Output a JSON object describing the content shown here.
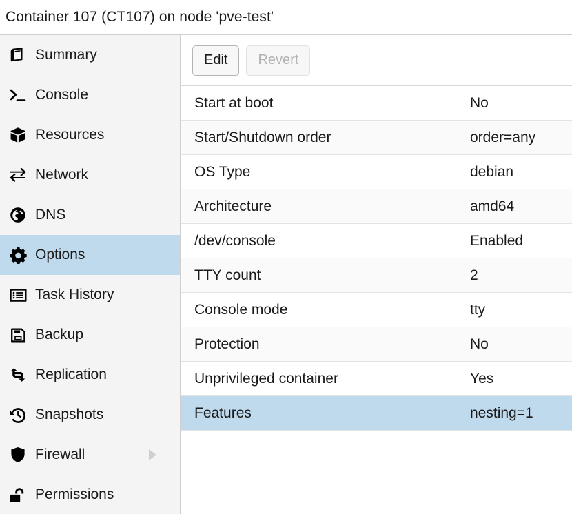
{
  "header": {
    "title": "Container 107 (CT107) on node 'pve-test'"
  },
  "sidebar": {
    "items": [
      {
        "label": "Summary",
        "icon": "book-icon",
        "selected": false,
        "has_submenu": false
      },
      {
        "label": "Console",
        "icon": "terminal-icon",
        "selected": false,
        "has_submenu": false
      },
      {
        "label": "Resources",
        "icon": "cube-icon",
        "selected": false,
        "has_submenu": false
      },
      {
        "label": "Network",
        "icon": "exchange-icon",
        "selected": false,
        "has_submenu": false
      },
      {
        "label": "DNS",
        "icon": "globe-icon",
        "selected": false,
        "has_submenu": false
      },
      {
        "label": "Options",
        "icon": "gear-icon",
        "selected": true,
        "has_submenu": false
      },
      {
        "label": "Task History",
        "icon": "list-icon",
        "selected": false,
        "has_submenu": false
      },
      {
        "label": "Backup",
        "icon": "floppy-disk-icon",
        "selected": false,
        "has_submenu": false
      },
      {
        "label": "Replication",
        "icon": "retweet-icon",
        "selected": false,
        "has_submenu": false
      },
      {
        "label": "Snapshots",
        "icon": "history-icon",
        "selected": false,
        "has_submenu": false
      },
      {
        "label": "Firewall",
        "icon": "shield-icon",
        "selected": false,
        "has_submenu": true
      },
      {
        "label": "Permissions",
        "icon": "unlock-icon",
        "selected": false,
        "has_submenu": false
      }
    ]
  },
  "toolbar": {
    "edit_label": "Edit",
    "revert_label": "Revert",
    "revert_disabled": true
  },
  "options_table": {
    "rows": [
      {
        "key": "Start at boot",
        "value": "No",
        "selected": false
      },
      {
        "key": "Start/Shutdown order",
        "value": "order=any",
        "selected": false
      },
      {
        "key": "OS Type",
        "value": "debian",
        "selected": false
      },
      {
        "key": "Architecture",
        "value": "amd64",
        "selected": false
      },
      {
        "key": "/dev/console",
        "value": "Enabled",
        "selected": false
      },
      {
        "key": "TTY count",
        "value": "2",
        "selected": false
      },
      {
        "key": "Console mode",
        "value": "tty",
        "selected": false
      },
      {
        "key": "Protection",
        "value": "No",
        "selected": false
      },
      {
        "key": "Unprivileged container",
        "value": "Yes",
        "selected": false
      },
      {
        "key": "Features",
        "value": "nesting=1",
        "selected": true
      }
    ]
  },
  "colors": {
    "selection_blue": "#bfd9ed",
    "sidebar_bg": "#f4f4f4",
    "row_alt_bg": "#fafafa",
    "border": "#e3e3e3"
  }
}
